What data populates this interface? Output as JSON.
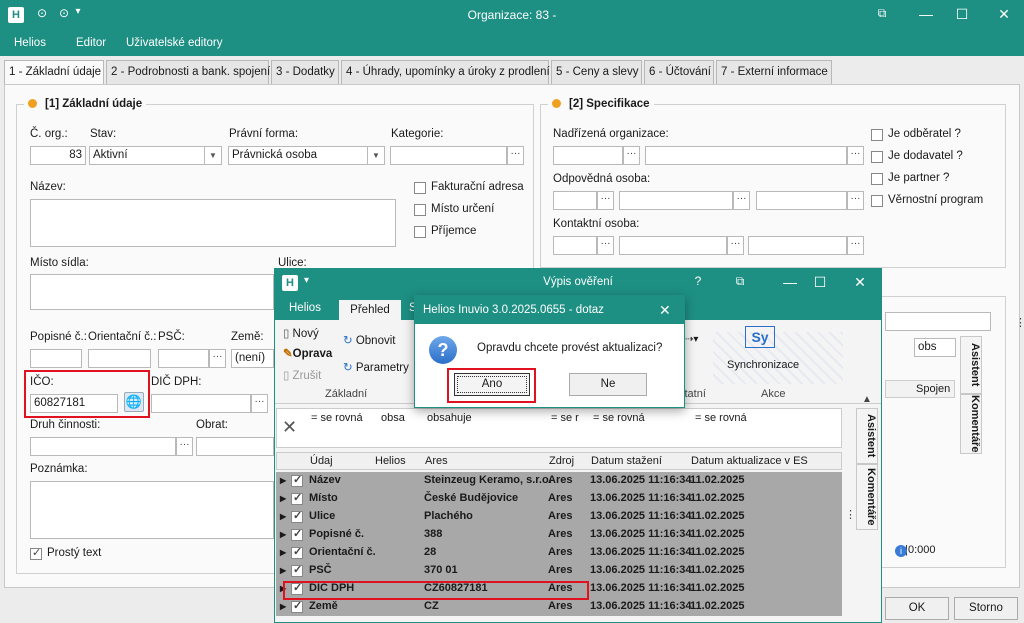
{
  "window": {
    "title": "Organizace: 83 -",
    "min": "—",
    "max": "☐",
    "close": "✕",
    "restore": "⧉",
    "pin": "▾"
  },
  "menu": [
    "Helios",
    "Editor",
    "Uživatelské editory"
  ],
  "tabs": [
    "1 - Základní údaje",
    "2 - Podrobnosti a bank. spojení",
    "3 - Dodatky",
    "4 - Úhrady, upomínky a úroky z prodlení",
    "5 - Ceny a slevy",
    "6 - Účtování",
    "7 - Externí informace"
  ],
  "basic": {
    "title": "[1] Základní údaje",
    "cislo_label": "Č. org.:",
    "cislo": "83",
    "stav_label": "Stav:",
    "stav": "Aktivní",
    "pravni_label": "Právní forma:",
    "pravni": "Právnická osoba",
    "kategorie_label": "Kategorie:",
    "nazev_label": "Název:",
    "fakt": "Fakturační adresa",
    "misto_urceni": "Místo určení",
    "prijemce": "Příjemce",
    "misto_label": "Místo sídla:",
    "ulice_label": "Ulice:",
    "popisne_label": "Popisné č.:",
    "orient_label": "Orientační č.:",
    "psc_label": "PSČ:",
    "zeme_label": "Země:",
    "zeme": "(není)",
    "ico_label": "IČO:",
    "ico": "60827181",
    "dic_label": "DIČ DPH:",
    "druh_label": "Druh činnosti:",
    "obrat_label": "Obrat:",
    "poznamka_label": "Poznámka:",
    "prosty": "Prostý text"
  },
  "spec": {
    "title": "[2] Specifikace",
    "nadrizena": "Nadřízená organizace:",
    "odpovedna": "Odpovědná osoba:",
    "kontaktni": "Kontaktní osoba:",
    "checks": [
      "Je odběratel ?",
      "Je dodavatel ?",
      "Je partner ?",
      "Věrnostní program"
    ]
  },
  "footer": {
    "ok": "OK",
    "storno": "Storno"
  },
  "side": {
    "asistent": "Asistent",
    "komentare": "Komentáře",
    "obs": "obs",
    "spojen": "Spojen",
    "status": "0|0:000"
  },
  "vypis": {
    "title": "Výpis ověření",
    "help": "?",
    "tabs": [
      "Helios",
      "Přehled",
      "S"
    ],
    "novy": "Nový",
    "oprava": "Oprava",
    "zrusit": "Zrušit",
    "obnovit": "Obnovit",
    "parametry": "Parametry",
    "group": "Základní",
    "ostatni": "statní",
    "sync": "Synchronizace",
    "akce": "Akce",
    "sy": "Sy",
    "filters": [
      "= se rovná",
      "obsa",
      "obsahuje",
      "= se r",
      "= se rovná",
      "= se rovná"
    ],
    "columns": [
      "Údaj",
      "Helios",
      "Ares",
      "Zdroj",
      "Datum stažení",
      "Datum aktualizace v ES"
    ],
    "rows": [
      [
        "Název",
        "",
        "Steinzeug Keramo, s.r.o.",
        "Ares",
        "13.06.2025 11:16:34",
        "11.02.2025"
      ],
      [
        "Místo",
        "",
        "České Budějovice",
        "Ares",
        "13.06.2025 11:16:34",
        "11.02.2025"
      ],
      [
        "Ulice",
        "",
        "Plachého",
        "Ares",
        "13.06.2025 11:16:34",
        "11.02.2025"
      ],
      [
        "Popisné č.",
        "",
        "388",
        "Ares",
        "13.06.2025 11:16:34",
        "11.02.2025"
      ],
      [
        "Orientační č.",
        "",
        "28",
        "Ares",
        "13.06.2025 11:16:34",
        "11.02.2025"
      ],
      [
        "PSČ",
        "",
        "370 01",
        "Ares",
        "13.06.2025 11:16:34",
        "11.02.2025"
      ],
      [
        "DIČ DPH",
        "",
        "CZ60827181",
        "Ares",
        "13.06.2025 11:16:34",
        "11.02.2025"
      ],
      [
        "Země",
        "",
        "CZ",
        "Ares",
        "13.06.2025 11:16:34",
        "11.02.2025"
      ]
    ]
  },
  "dialog": {
    "title": "Helios Inuvio 3.0.2025.0655 - dotaz",
    "message": "Opravdu chcete provést aktualizaci?",
    "yes": "Ano",
    "no": "Ne",
    "close": "✕"
  }
}
